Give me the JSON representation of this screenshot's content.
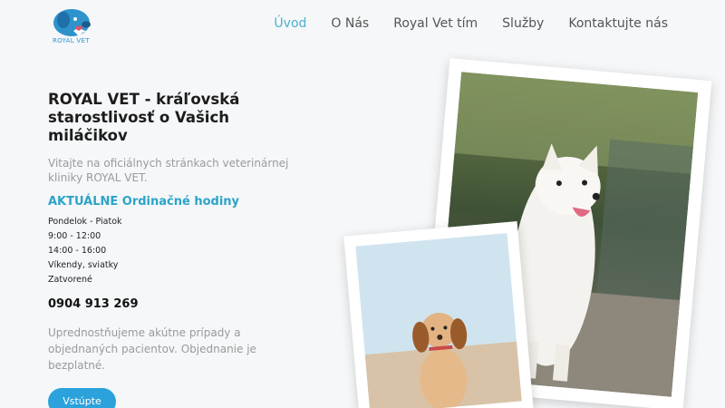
{
  "header": {
    "logo_text": "ROYAL VET",
    "nav": [
      {
        "label": "Úvod",
        "active": true
      },
      {
        "label": "O Nás",
        "active": false
      },
      {
        "label": "Royal Vet tím",
        "active": false
      },
      {
        "label": "Služby",
        "active": false
      },
      {
        "label": "Kontaktujte nás",
        "active": false
      }
    ]
  },
  "hero": {
    "title": "ROYAL VET - kráľovská starostlivosť o Vašich miláčikov",
    "intro": "Vitajte na oficiálnych stránkach veterinárnej kliniky ROYAL VET.",
    "hours_heading": "AKTUÁLNE Ordinačné hodiny",
    "hours": [
      "Pondelok - Piatok",
      "9:00 - 12:00",
      "14:00 - 16:00",
      "Víkendy, sviatky",
      "Zatvorené"
    ],
    "phone": "0904 913 269",
    "note": "Uprednostňujeme akútne prípady a objednaných pacientov. Objednanie je bezplatné.",
    "cta_label": "Vstúpte"
  },
  "colors": {
    "accent": "#2ba2dc",
    "nav_active": "#4fb0cc",
    "heading_accent": "#2ba4c6",
    "muted_text": "#9a9a9a",
    "background": "#f5f7f9"
  },
  "icons": {
    "logo": "dog-heart-logo-icon"
  }
}
